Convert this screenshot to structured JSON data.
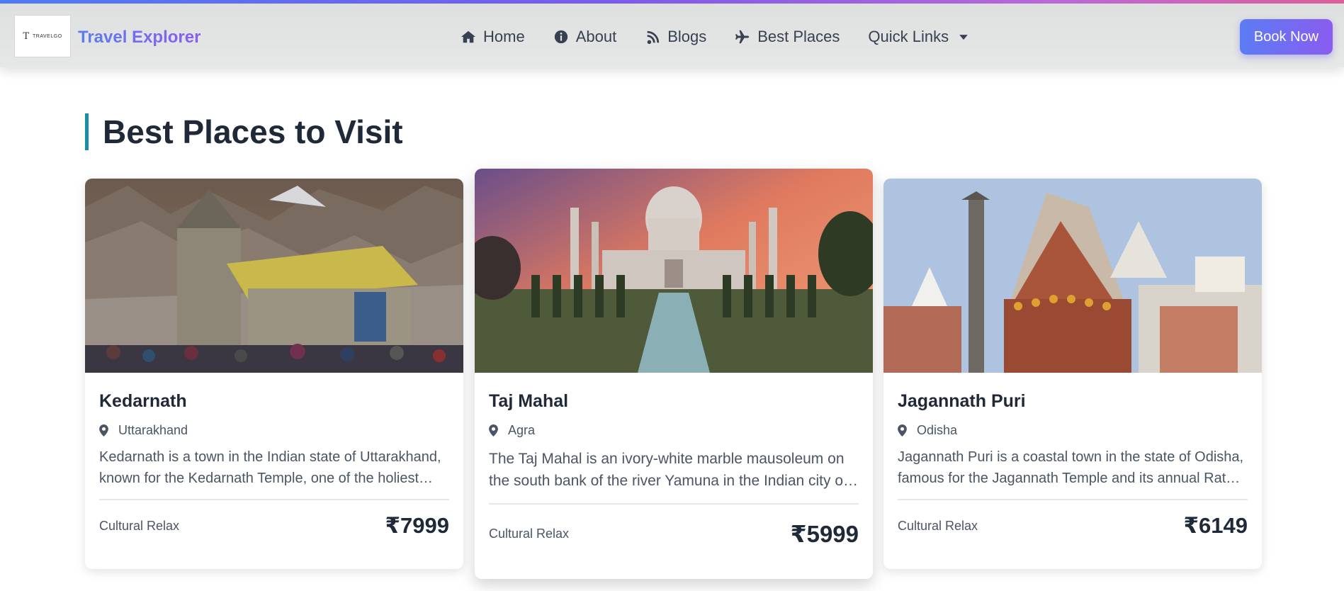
{
  "header": {
    "logo_mark": "T",
    "logo_text": "TRAVELGO",
    "brand": "Travel Explorer",
    "nav": [
      {
        "label": "Home",
        "icon": "home-icon"
      },
      {
        "label": "About",
        "icon": "info-icon"
      },
      {
        "label": "Blogs",
        "icon": "blog-icon"
      },
      {
        "label": "Best Places",
        "icon": "plane-icon"
      },
      {
        "label": "Quick Links",
        "icon": "chevron-down-icon"
      }
    ],
    "cta_label": "Book Now"
  },
  "section": {
    "title": "Best Places to Visit"
  },
  "cards": [
    {
      "name": "Kedarnath",
      "location": "Uttarakhand",
      "description": "Kedarnath is a town in the Indian state of Uttarakhand, known for the Kedarnath Temple, one of the holiest Hindu shrines.",
      "category": "Cultural Relax",
      "price": "₹7999"
    },
    {
      "name": "Taj Mahal",
      "location": "Agra",
      "description": "The Taj Mahal is an ivory-white marble mausoleum on the south bank of the river Yamuna in the Indian city of Agra.",
      "category": "Cultural Relax",
      "price": "₹5999"
    },
    {
      "name": "Jagannath Puri",
      "location": "Odisha",
      "description": "Jagannath Puri is a coastal town in the state of Odisha, famous for the Jagannath Temple and its annual Rath Yatra.",
      "category": "Cultural Relax",
      "price": "₹6149"
    }
  ],
  "colors": {
    "accent_gradient_start": "#5b7cf5",
    "accent_gradient_end": "#8a5cf0",
    "title_bar": "#1c8ca8",
    "text_dark": "#1f2937",
    "text_muted": "#4b5563"
  }
}
